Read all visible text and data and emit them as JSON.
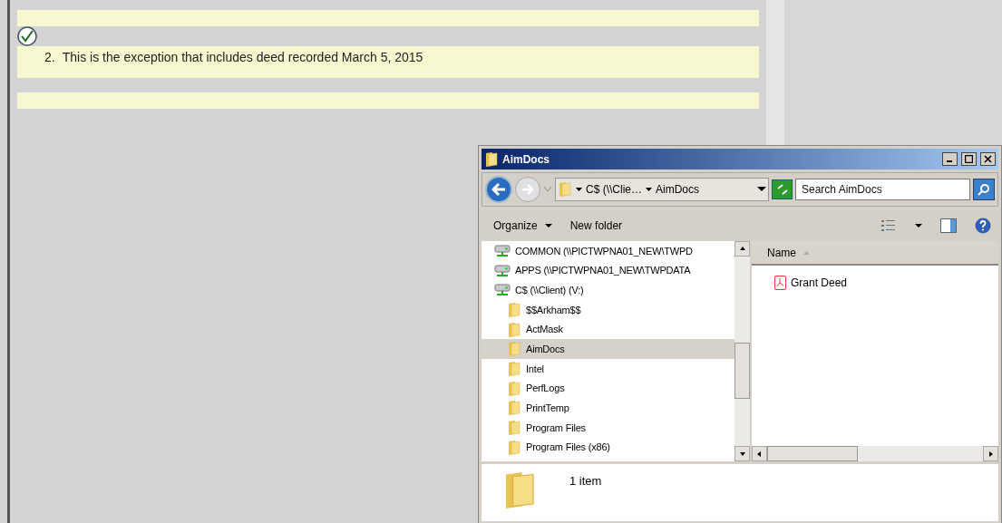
{
  "document": {
    "rows": [
      {
        "kind": "empty"
      },
      {
        "kind": "exception",
        "checked": true,
        "number": "2.",
        "text": "This is the exception that includes deed recorded March 5, 2015"
      },
      {
        "kind": "empty"
      }
    ]
  },
  "explorer": {
    "title": "AimDocs",
    "address": {
      "crumbs": [
        "C$ (\\\\Clie…",
        "AimDocs"
      ]
    },
    "search": {
      "placeholder": "Search AimDocs"
    },
    "toolbar": [
      {
        "label": "Organize",
        "dropdown": true
      },
      {
        "label": "New folder",
        "dropdown": false
      }
    ],
    "tree": [
      {
        "kind": "drive",
        "label": "COMMON (\\\\PICTWPNA01_NEW\\TWPD",
        "selected": false
      },
      {
        "kind": "drive",
        "label": "APPS (\\\\PICTWPNA01_NEW\\TWPDATA",
        "selected": false
      },
      {
        "kind": "drive",
        "label": "C$ (\\\\Client) (V:)",
        "selected": false,
        "children": [
          {
            "kind": "folder",
            "label": "$$Arkham$$",
            "selected": false
          },
          {
            "kind": "folder",
            "label": "ActMask",
            "selected": false
          },
          {
            "kind": "folder",
            "label": "AimDocs",
            "selected": true
          },
          {
            "kind": "folder",
            "label": "Intel",
            "selected": false
          },
          {
            "kind": "folder",
            "label": "PerfLogs",
            "selected": false
          },
          {
            "kind": "folder",
            "label": "PrintTemp",
            "selected": false
          },
          {
            "kind": "folder",
            "label": "Program Files",
            "selected": false
          },
          {
            "kind": "folder",
            "label": "Program Files (x86)",
            "selected": false
          }
        ]
      }
    ],
    "columns": [
      "Name"
    ],
    "files": [
      {
        "kind": "pdf",
        "name": "Grant Deed"
      }
    ],
    "status": "1 item"
  }
}
